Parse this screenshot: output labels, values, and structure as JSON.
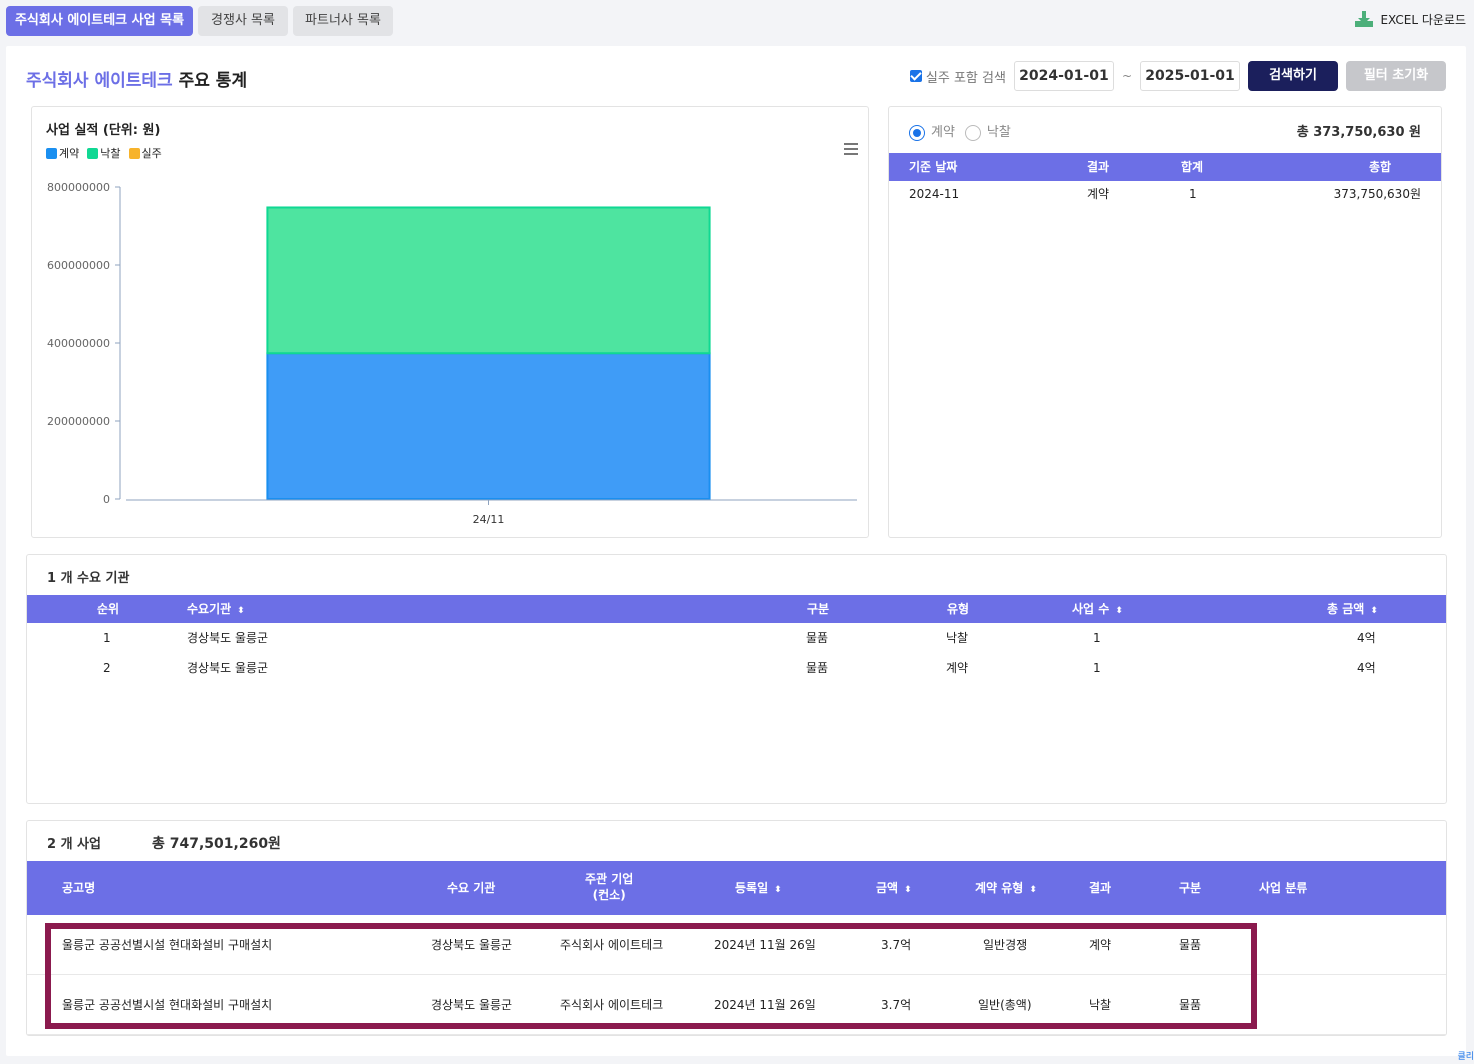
{
  "tabs": [
    {
      "label": "주식회사 에이트테크 사업 목록",
      "active": true
    },
    {
      "label": "경쟁사 목록",
      "active": false
    },
    {
      "label": "파트너사 목록",
      "active": false
    }
  ],
  "excel": {
    "label": "EXCEL 다운로드",
    "icon": "download-icon"
  },
  "header": {
    "title_accent": "주식회사 에이트테크",
    "title_rest": " 주요 통계"
  },
  "filters": {
    "include_label": "실주 포함 검색",
    "include_checked": true,
    "start_date": "2024-01-01",
    "separator": "~",
    "end_date": "2025-01-01",
    "search_button": "검색하기",
    "reset_button": "필터 초기화"
  },
  "chart_data": {
    "type": "bar",
    "stacked": true,
    "title": "사업 실적 (단위: 원)",
    "categories": [
      "24/11"
    ],
    "series": [
      {
        "name": "계약",
        "values": [
          373750630
        ],
        "color": "#3f9cf7"
      },
      {
        "name": "낙찰",
        "values": [
          373750630
        ],
        "color": "#4ee4a0"
      },
      {
        "name": "실주",
        "values": [
          0
        ],
        "color": "#f7b32b"
      }
    ],
    "ylim": [
      0,
      800000000
    ],
    "yticks": [
      "800000000",
      "600000000",
      "400000000",
      "200000000",
      "0"
    ],
    "ytick_values": [
      800000000,
      600000000,
      400000000,
      200000000,
      0
    ],
    "legend": "top-left",
    "grid": false
  },
  "summary": {
    "radio_contract": "계약",
    "radio_award": "낙찰",
    "total": "총 373,750,630 원",
    "columns": [
      "기준 날짜",
      "결과",
      "합계",
      "총합"
    ],
    "rows": [
      {
        "date": "2024-11",
        "result": "계약",
        "count": "1",
        "sum": "373,750,630원"
      }
    ]
  },
  "agencies": {
    "title": "1 개 수요 기관",
    "columns": [
      "순위",
      "수요기관",
      "구분",
      "유형",
      "사업 수",
      "총 금액"
    ],
    "rows": [
      {
        "rank": "1",
        "name": "경상북도 울릉군",
        "category": "물품",
        "type": "낙찰",
        "count": "1",
        "amount": "4억"
      },
      {
        "rank": "2",
        "name": "경상북도 울릉군",
        "category": "물품",
        "type": "계약",
        "count": "1",
        "amount": "4억"
      }
    ]
  },
  "projects": {
    "title": "2 개 사업",
    "total": "총 747,501,260원",
    "columns": [
      "공고명",
      "수요 기관",
      "주관 기업",
      "(컨소)",
      "등록일",
      "금액",
      "계약 유형",
      "결과",
      "구분",
      "사업 분류"
    ],
    "rows": [
      {
        "name": "울릉군 공공선별시설 현대화설비 구매설치",
        "agency": "경상북도 울릉군",
        "company": "주식회사 에이트테크",
        "date": "2024년 11월 26일",
        "amount": "3.7억",
        "contract_type": "일반경쟁",
        "result": "계약",
        "category": "물품",
        "classification": ""
      },
      {
        "name": "울릉군 공공선별시설 현대화설비 구매설치",
        "agency": "경상북도 울릉군",
        "company": "주식회사 에이트테크",
        "date": "2024년 11월 26일",
        "amount": "3.7억",
        "contract_type": "일반(총액)",
        "result": "낙찰",
        "category": "물품",
        "classification": ""
      }
    ]
  },
  "corner_text": "클리"
}
